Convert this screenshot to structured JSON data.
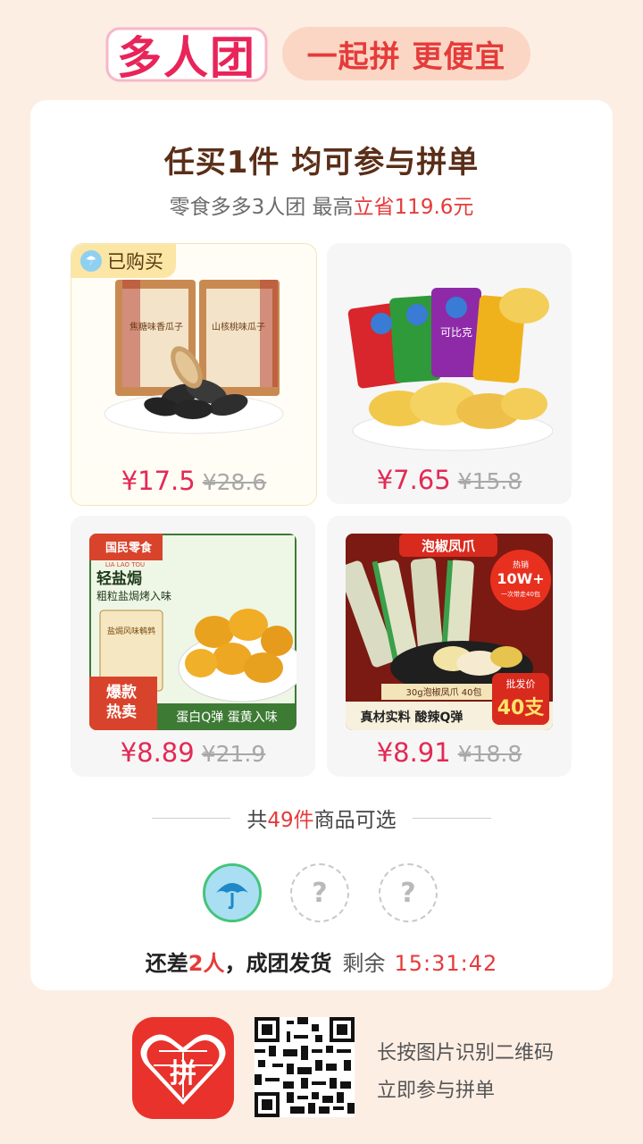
{
  "header": {
    "brand": "多人团",
    "slogan": "一起拼 更便宜"
  },
  "card": {
    "headline": "任买1件 均可参与拼单",
    "sub_prefix": "零食多多3人团 最高",
    "sub_highlight": "立省119.6元"
  },
  "products": [
    {
      "name_icon": "sunflower-seeds",
      "price": "¥17.5",
      "orig": "¥28.6",
      "tag": "已购买",
      "img_label": "山核桃味瓜子"
    },
    {
      "name_icon": "potato-chips",
      "price": "¥7.65",
      "orig": "¥15.8",
      "img_label": "可比克"
    },
    {
      "name_icon": "quail-eggs",
      "price": "¥8.89",
      "orig": "¥21.9",
      "img_brand": "国民零食",
      "img_brand_en": "LIA LAO TOU",
      "img_title": "轻盐焗",
      "img_sub": "粗粒盐焗烤入味",
      "img_badge_1": "爆款",
      "img_badge_2": "热卖",
      "img_bottom": "蛋白Q弹 蛋黄入味",
      "img_pack": "盐焗风味鹌鹑"
    },
    {
      "name_icon": "chicken-feet",
      "price": "¥8.91",
      "orig": "¥18.8",
      "img_title": "泡椒凤爪",
      "img_burst_1": "热销",
      "img_burst_2": "10W+",
      "img_burst_3": "一次带走40包",
      "img_pack": "30g泡椒凤爪 40包",
      "img_bottom": "真材实料 酸辣Q弹",
      "img_tag_small": "批发价",
      "img_tag_big": "40支"
    }
  ],
  "count": {
    "prefix": "共",
    "number": "49件",
    "suffix": "商品可选"
  },
  "group": {
    "empty_mark": "?",
    "status_prefix": "还差",
    "status_number": "2人",
    "status_suffix": "，成团发货",
    "remain_label": "剩余",
    "timer": "15:31:42"
  },
  "footer": {
    "app_text": "拼",
    "line1": "长按图片识别二维码",
    "line2": "立即参与拼单"
  },
  "colors": {
    "accent": "#e53b3b",
    "price": "#e22a55",
    "headline": "#5a2e18",
    "background": "#fdeee4"
  }
}
